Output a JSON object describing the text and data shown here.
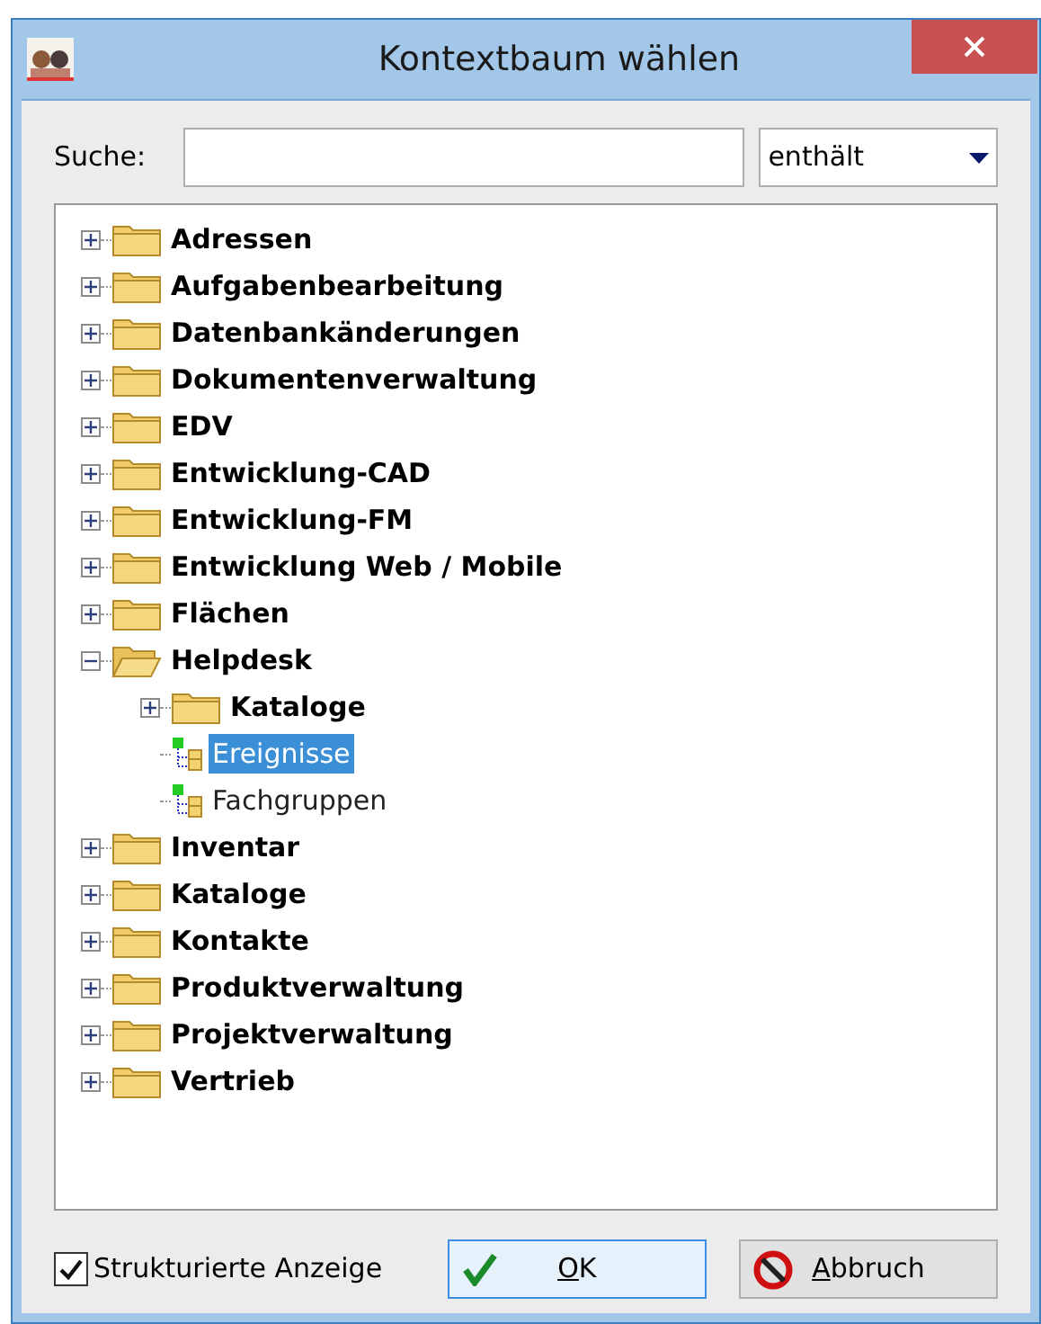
{
  "window": {
    "title": "Kontextbaum wählen"
  },
  "search": {
    "label": "Suche:",
    "mode": "enthält"
  },
  "tree": [
    {
      "label": "Adressen",
      "kind": "folder",
      "expanded": false,
      "selected": false
    },
    {
      "label": "Aufgabenbearbeitung",
      "kind": "folder",
      "expanded": false,
      "selected": false
    },
    {
      "label": "Datenbankänderungen",
      "kind": "folder",
      "expanded": false,
      "selected": false
    },
    {
      "label": "Dokumentenverwaltung",
      "kind": "folder",
      "expanded": false,
      "selected": false
    },
    {
      "label": "EDV",
      "kind": "folder",
      "expanded": false,
      "selected": false
    },
    {
      "label": "Entwicklung-CAD",
      "kind": "folder",
      "expanded": false,
      "selected": false
    },
    {
      "label": "Entwicklung-FM",
      "kind": "folder",
      "expanded": false,
      "selected": false
    },
    {
      "label": "Entwicklung Web / Mobile",
      "kind": "folder",
      "expanded": false,
      "selected": false
    },
    {
      "label": "Flächen",
      "kind": "folder",
      "expanded": false,
      "selected": false
    },
    {
      "label": "Helpdesk",
      "kind": "folder",
      "expanded": true,
      "selected": false,
      "children": [
        {
          "label": "Kataloge",
          "kind": "folder",
          "expanded": false,
          "selected": false
        },
        {
          "label": "Ereignisse",
          "kind": "leaf",
          "selected": true
        },
        {
          "label": "Fachgruppen",
          "kind": "leaf",
          "selected": false
        }
      ]
    },
    {
      "label": "Inventar",
      "kind": "folder",
      "expanded": false,
      "selected": false
    },
    {
      "label": "Kataloge",
      "kind": "folder",
      "expanded": false,
      "selected": false
    },
    {
      "label": "Kontakte",
      "kind": "folder",
      "expanded": false,
      "selected": false
    },
    {
      "label": "Produktverwaltung",
      "kind": "folder",
      "expanded": false,
      "selected": false
    },
    {
      "label": "Projektverwaltung",
      "kind": "folder",
      "expanded": false,
      "selected": false
    },
    {
      "label": "Vertrieb",
      "kind": "folder",
      "expanded": false,
      "selected": false
    }
  ],
  "structured": {
    "label": "Strukturierte Anzeige",
    "checked": true
  },
  "buttons": [
    {
      "kind": "ok",
      "accel": "O",
      "rest": "K",
      "focused": true
    },
    {
      "kind": "cancel",
      "accel": "A",
      "rest": "bbruch",
      "focused": false
    }
  ]
}
